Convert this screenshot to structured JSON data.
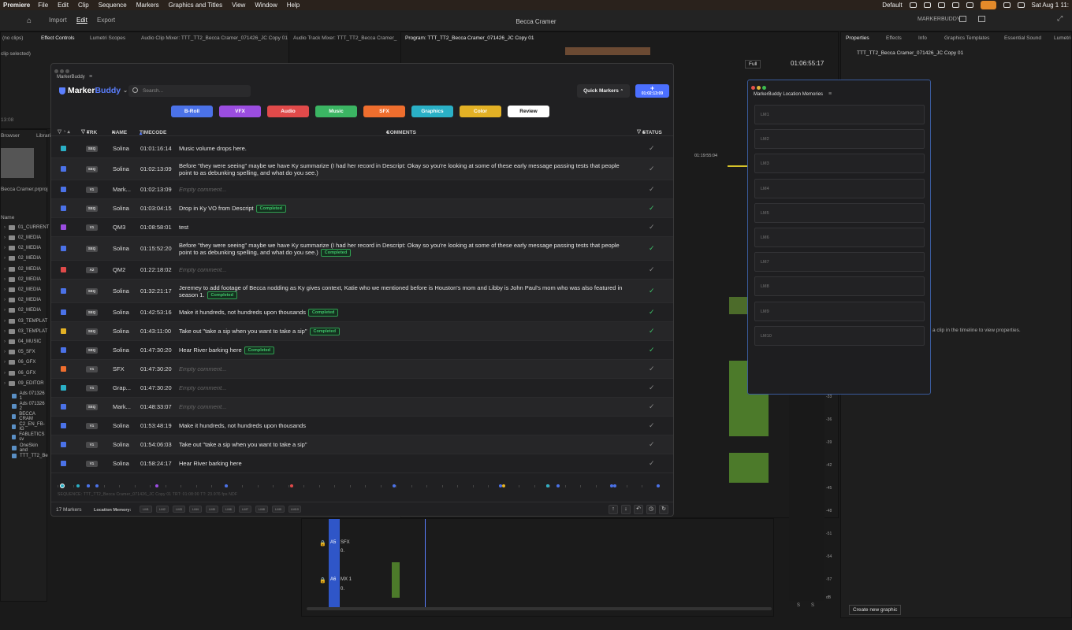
{
  "menubar": {
    "app": "Premiere",
    "items": [
      "File",
      "Edit",
      "Clip",
      "Sequence",
      "Markers",
      "Graphics and Titles",
      "View",
      "Window",
      "Help"
    ],
    "workspace": "Default",
    "clock": "Sat Aug 1  11:"
  },
  "header": {
    "tabs": [
      "Import",
      "Edit",
      "Export"
    ],
    "project_title": "Becca Cramer",
    "user": "MARKERBUDDY"
  },
  "left_panel": {
    "tabs": [
      "Effect Controls",
      "Lumetri Scopes",
      "Audio Clip Mixer: TTT_TT2_Becca Cramer_071426_JC Copy 01",
      "Audio Track Mixer: TTT_TT2_Becca Cramer_"
    ],
    "no_clips": "(no clips)",
    "clip_selected": "clip selected)",
    "time": "13:08",
    "browser_tabs": [
      "Browser",
      "Librarie"
    ],
    "project_file": "Becca Cramer.prproj",
    "name_col": "Name",
    "folders": [
      "01_CURRENT",
      "02_MEDIA",
      "02_MEDIA",
      "02_MEDIA",
      "02_MEDIA",
      "02_MEDIA",
      "02_MEDIA",
      "02_MEDIA",
      "02_MEDIA",
      "03_TEMPLAT",
      "03_TEMPLAT",
      "04_MUSIC",
      "05_SFX",
      "06_GFX",
      "06_GFX",
      "09_EDITOR"
    ],
    "files": [
      "Ads 071326 1",
      "Ads 071326 2",
      "BECCA CRAM",
      "C2_EN_FB-IG",
      "FABLETICS sv",
      "OneSkin and",
      "TTT_TT2_Be"
    ]
  },
  "program": {
    "title": "Program: TTT_TT2_Becca Cramer_071426_JC Copy 01",
    "fit": "Full",
    "timecode": "01:06:55:17",
    "ruler_tc": "01:19:55:04"
  },
  "right_panel": {
    "tabs": [
      "Properties",
      "Effects",
      "Info",
      "Graphics Templates",
      "Essential Sound",
      "Lumetri"
    ],
    "sequence": "TTT_TT2_Becca Cramer_071426_JC Copy 01",
    "hint": "a clip in the timeline to view properties.",
    "create_graphic": "Create new graphic",
    "db_scale": [
      "-33",
      "-36",
      "-39",
      "-42",
      "-45",
      "-48",
      "-51",
      "-54",
      "-57",
      "dB"
    ],
    "solo": [
      "S",
      "S"
    ]
  },
  "tracks": [
    {
      "id": "A5",
      "name": "SFX",
      "vol": "0."
    },
    {
      "id": "A6",
      "name": "MX 1",
      "vol": "0."
    }
  ],
  "markerbuddy": {
    "window_title": "MarkerBuddy",
    "logo_a": "Marker",
    "logo_b": "Buddy",
    "search_placeholder": "Search...",
    "quick_markers": "Quick Markers",
    "add_timecode": "01:02:13:09",
    "categories": [
      {
        "label": "B-Roll",
        "color": "#4b72e8"
      },
      {
        "label": "VFX",
        "color": "#9b4de0"
      },
      {
        "label": "Audio",
        "color": "#e04a4a"
      },
      {
        "label": "Music",
        "color": "#3bb563"
      },
      {
        "label": "SFX",
        "color": "#ef6e2e"
      },
      {
        "label": "Graphics",
        "color": "#2ab0c6"
      },
      {
        "label": "Color",
        "color": "#e3b125"
      },
      {
        "label": "Review",
        "color": "#ffffff"
      }
    ],
    "columns": {
      "trk": "TRK",
      "name": "NAME",
      "timecode": "TIMECODE",
      "comments": "COMMENTS",
      "status": "STATUS"
    },
    "completed_label": "Completed",
    "empty_comment": "Empty comment...",
    "markers": [
      {
        "color": "#2ab0c6",
        "trk": "SEQ",
        "name": "Solina",
        "tc": "01:01:16:14",
        "comment": "Music volume drops here.",
        "badge": false,
        "done": false
      },
      {
        "color": "#4b72e8",
        "trk": "SEQ",
        "name": "Solina",
        "tc": "01:02:13:09",
        "comment": "Before \"they were seeing\" maybe we have Ky summarize (I had her record in Descript: Okay so you're looking at some of these early message passing tests that people point to as debunking spelling, and what do you see.)",
        "badge": false,
        "done": false
      },
      {
        "color": "#4b72e8",
        "trk": "V1",
        "name": "Mark...",
        "tc": "01:02:13:09",
        "comment": "",
        "badge": false,
        "done": false
      },
      {
        "color": "#4b72e8",
        "trk": "SEQ",
        "name": "Solina",
        "tc": "01:03:04:15",
        "comment": "Drop in Ky VO from Descript",
        "badge": true,
        "done": true
      },
      {
        "color": "#9b4de0",
        "trk": "V1",
        "name": "QM3",
        "tc": "01:08:58:01",
        "comment": "test",
        "badge": false,
        "done": false
      },
      {
        "color": "#4b72e8",
        "trk": "SEQ",
        "name": "Solina",
        "tc": "01:15:52:20",
        "comment": "Before \"they were seeing\" maybe we have Ky summarize (I had her record in Descript: Okay so you're looking at some of these early message passing tests that people point to as debunking spelling, and what do you see.)",
        "badge": true,
        "done": true
      },
      {
        "color": "#e04a4a",
        "trk": "A2",
        "name": "QM2",
        "tc": "01:22:18:02",
        "comment": "",
        "badge": false,
        "done": false
      },
      {
        "color": "#4b72e8",
        "trk": "SEQ",
        "name": "Solina",
        "tc": "01:32:21:17",
        "comment": "Jeremey to add footage of Becca nodding as Ky gives context, Katie who we mentioned before is Houston's mom and Libby is John Paul's mom who was also featured in season 1.",
        "badge": true,
        "done": true
      },
      {
        "color": "#4b72e8",
        "trk": "SEQ",
        "name": "Solina",
        "tc": "01:42:53:16",
        "comment": "Make it hundreds, not hundreds upon thousands",
        "badge": true,
        "done": true
      },
      {
        "color": "#e3b125",
        "trk": "SEQ",
        "name": "Solina",
        "tc": "01:43:11:00",
        "comment": "Take out \"take a sip when you want to take a sip\"",
        "badge": true,
        "done": true
      },
      {
        "color": "#4b72e8",
        "trk": "SEQ",
        "name": "Solina",
        "tc": "01:47:30:20",
        "comment": "Hear River barking here",
        "badge": true,
        "done": true
      },
      {
        "color": "#ef6e2e",
        "trk": "V1",
        "name": "SFX",
        "tc": "01:47:30:20",
        "comment": "",
        "badge": false,
        "done": false
      },
      {
        "color": "#2ab0c6",
        "trk": "V1",
        "name": "Grap...",
        "tc": "01:47:30:20",
        "comment": "",
        "badge": false,
        "done": false
      },
      {
        "color": "#4b72e8",
        "trk": "SEQ",
        "name": "Mark...",
        "tc": "01:48:33:07",
        "comment": "",
        "badge": false,
        "done": false
      },
      {
        "color": "#4b72e8",
        "trk": "V1",
        "name": "Solina",
        "tc": "01:53:48:19",
        "comment": "Make it hundreds, not hundreds upon thousands",
        "badge": false,
        "done": false
      },
      {
        "color": "#4b72e8",
        "trk": "V1",
        "name": "Solina",
        "tc": "01:54:06:03",
        "comment": "Take out \"take a sip when you want to take a sip\"",
        "badge": false,
        "done": false
      },
      {
        "color": "#4b72e8",
        "trk": "V1",
        "name": "Solina",
        "tc": "01:58:24:17",
        "comment": "Hear River barking here",
        "badge": false,
        "done": false
      }
    ],
    "sequence_line": "SEQUENCE: TTT_TT2_Becca Cramer_071426_JC Copy 01  TRT: 01:08:00  TT: 23.976 fps NDF",
    "marker_count": "17 Markers",
    "location_memory_label": "Location Memory:",
    "lm_chips": [
      "LM1",
      "LM2",
      "LM3",
      "LM4",
      "LM5",
      "LM6",
      "LM7",
      "LM8",
      "LM9",
      "LM10"
    ]
  },
  "location_memories": {
    "title": "MarkerBuddy Location Memories",
    "slots": [
      "LM1",
      "LM2",
      "LM3",
      "LM4",
      "LM5",
      "LM6",
      "LM7",
      "LM8",
      "LM9",
      "LM10"
    ]
  }
}
